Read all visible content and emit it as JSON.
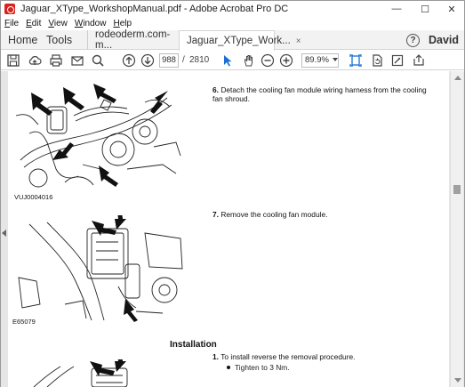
{
  "window": {
    "title": "Jaguar_XType_WorkshopManual.pdf - Adobe Acrobat Pro DC",
    "controls": {
      "minimize": "—",
      "maximize": "☐",
      "close": "✕"
    }
  },
  "menu": [
    {
      "prefix": "",
      "accel": "F",
      "rest": "ile"
    },
    {
      "prefix": "",
      "accel": "E",
      "rest": "dit"
    },
    {
      "prefix": "",
      "accel": "V",
      "rest": "iew"
    },
    {
      "prefix": "",
      "accel": "W",
      "rest": "indow"
    },
    {
      "prefix": "",
      "accel": "H",
      "rest": "elp"
    }
  ],
  "tabs": {
    "home": "Home",
    "tools": "Tools",
    "doc1": "rodeoderm.com-m...",
    "doc2": "Jaguar_XType_Work...",
    "close_glyph": "×"
  },
  "user": {
    "name": "David",
    "help_glyph": "?"
  },
  "toolbar": {
    "page_current": "988",
    "page_sep": "/",
    "page_total": "2810",
    "zoom": "89.9%"
  },
  "document": {
    "step6_num": "6.",
    "step6_text": "Detach the cooling fan module wiring harness from the cooling fan shroud.",
    "fig1_caption": "VUJ0004016",
    "step7_num": "7.",
    "step7_text": "Remove the cooling fan module.",
    "fig2_caption": "E65079",
    "installation_heading": "Installation",
    "inst1_num": "1.",
    "inst1_text": "To install reverse the removal procedure.",
    "inst1_bullet": "Tighten to 3 Nm."
  },
  "colors": {
    "acrobat_red": "#d9231f",
    "toolbar_blue": "#1a6fd1",
    "tab_bg": "#f2f2f2",
    "doc_bg": "#e6e6e6"
  }
}
